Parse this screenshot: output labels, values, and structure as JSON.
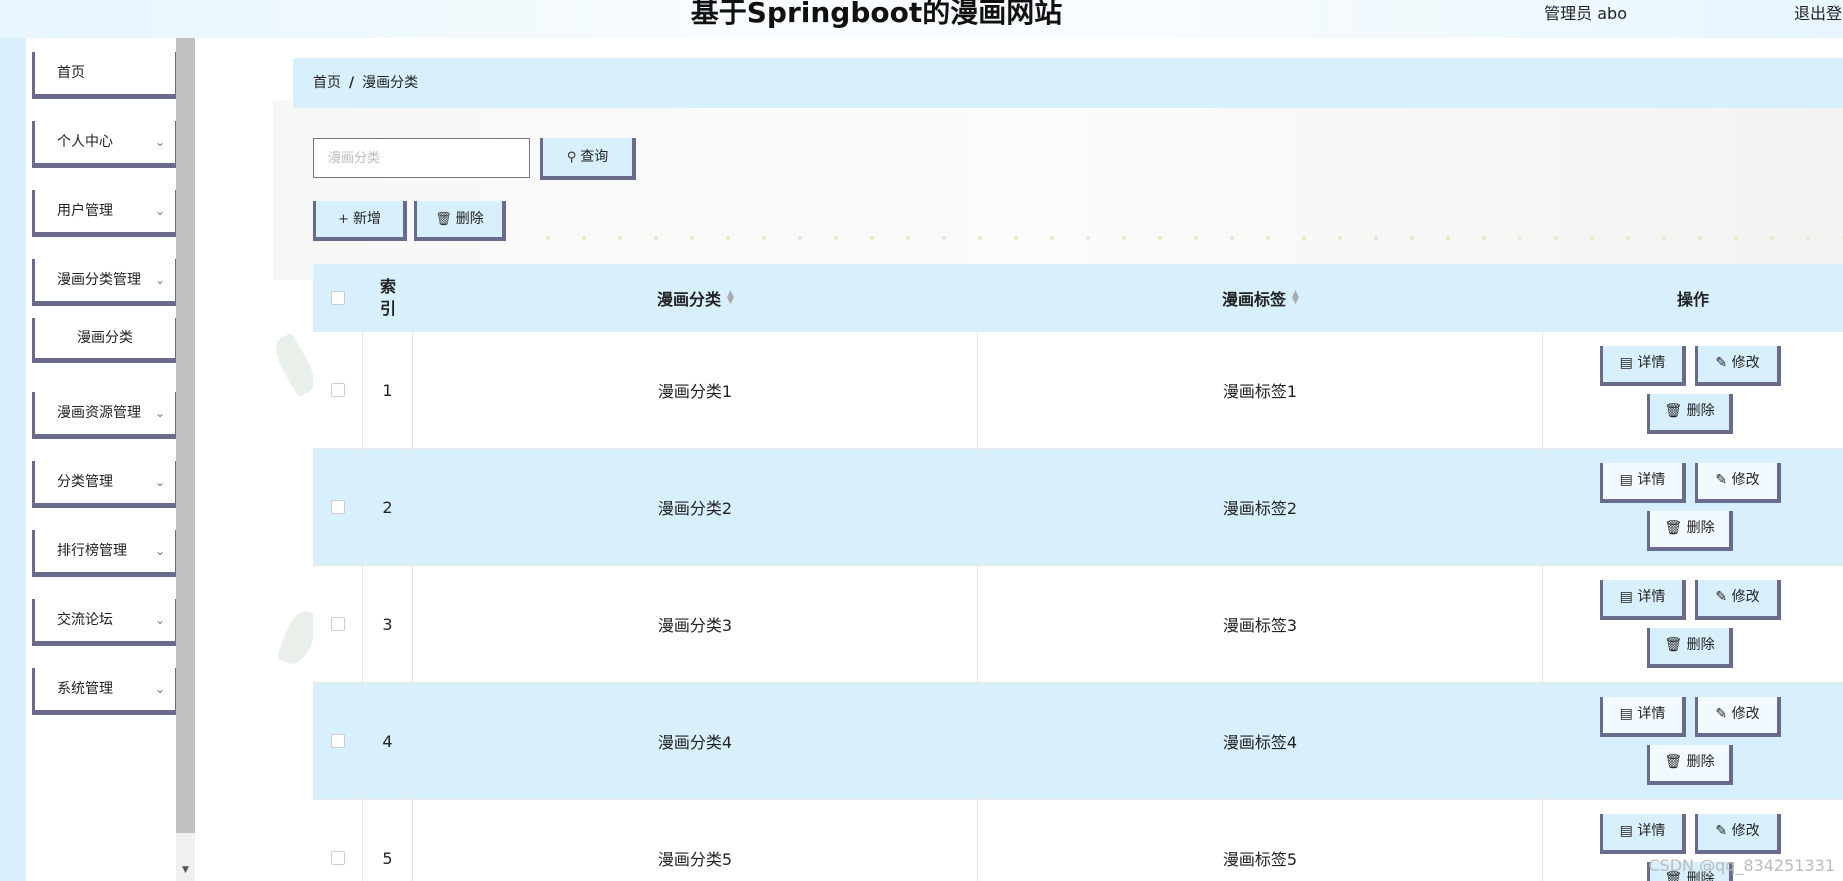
{
  "header": {
    "site_title": "基于Springboot的漫画网站",
    "user_info": "管理员 abo",
    "logout_label": "退出登"
  },
  "sidebar": {
    "items": [
      {
        "label": "首页",
        "has_submenu": false
      },
      {
        "label": "个人中心",
        "has_submenu": true
      },
      {
        "label": "用户管理",
        "has_submenu": true
      },
      {
        "label": "漫画分类管理",
        "has_submenu": true
      },
      {
        "label": "漫画分类",
        "is_subitem": true
      },
      {
        "label": "漫画资源管理",
        "has_submenu": true
      },
      {
        "label": "分类管理",
        "has_submenu": true
      },
      {
        "label": "排行榜管理",
        "has_submenu": true
      },
      {
        "label": "交流论坛",
        "has_submenu": true
      },
      {
        "label": "系统管理",
        "has_submenu": true
      }
    ]
  },
  "breadcrumb": {
    "home": "首页",
    "separator": "/",
    "current": "漫画分类"
  },
  "search": {
    "placeholder": "漫画分类",
    "value": "",
    "query_label": "查询"
  },
  "toolbar": {
    "add_label": "新增",
    "delete_label": "删除"
  },
  "table": {
    "headers": {
      "index": "索引",
      "category": "漫画分类",
      "tag": "漫画标签",
      "actions": "操作"
    },
    "rows": [
      {
        "index": "1",
        "category": "漫画分类1",
        "tag": "漫画标签1"
      },
      {
        "index": "2",
        "category": "漫画分类2",
        "tag": "漫画标签2"
      },
      {
        "index": "3",
        "category": "漫画分类3",
        "tag": "漫画标签3"
      },
      {
        "index": "4",
        "category": "漫画分类4",
        "tag": "漫画标签4"
      },
      {
        "index": "5",
        "category": "漫画分类5",
        "tag": "漫画标签5"
      }
    ],
    "row_actions": {
      "detail_label": "详情",
      "edit_label": "修改",
      "delete_label": "删除"
    }
  },
  "watermark": "CSDN @qq_834251331",
  "colors": {
    "accent_light_blue": "#d8f0fc",
    "button_border": "#6a6a8c"
  }
}
